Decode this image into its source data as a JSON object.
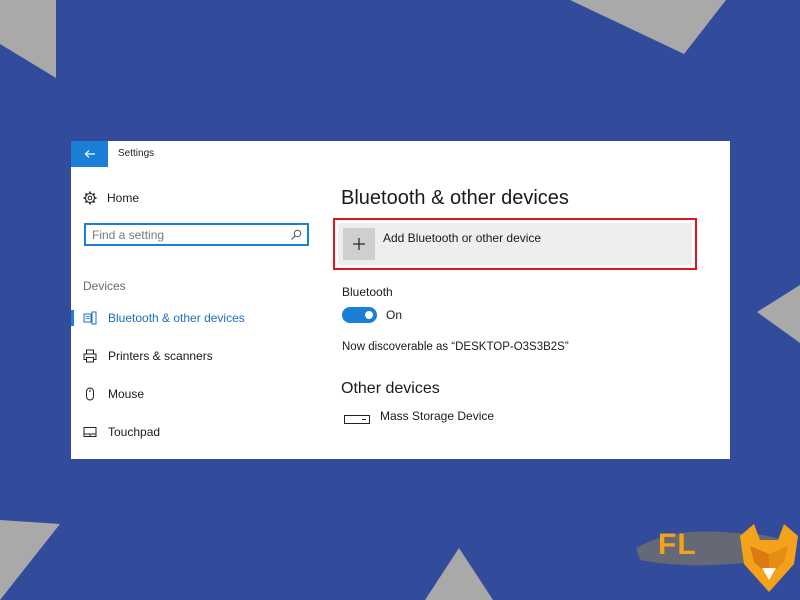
{
  "window": {
    "title": "Settings"
  },
  "sidebar": {
    "home_label": "Home",
    "search_placeholder": "Find a setting",
    "section_label": "Devices",
    "items": [
      {
        "label": "Bluetooth & other devices",
        "icon": "bluetooth-devices-icon",
        "active": true
      },
      {
        "label": "Printers & scanners",
        "icon": "printer-icon",
        "active": false
      },
      {
        "label": "Mouse",
        "icon": "mouse-icon",
        "active": false
      },
      {
        "label": "Touchpad",
        "icon": "touchpad-icon",
        "active": false
      }
    ]
  },
  "main": {
    "title": "Bluetooth & other devices",
    "add_device_label": "Add Bluetooth or other device",
    "bluetooth_label": "Bluetooth",
    "toggle_state": "On",
    "toggle_on": true,
    "discoverable_text": "Now discoverable as “DESKTOP-O3S3B2S”",
    "other_devices_title": "Other devices",
    "devices": [
      {
        "label": "Mass Storage Device",
        "icon": "storage-device-icon"
      }
    ]
  },
  "logo": {
    "text": "FL"
  },
  "colors": {
    "background": "#324b9b",
    "accent": "#1a7fd6",
    "highlight_border": "#e0141e",
    "logo_orange": "#f5a21b"
  }
}
